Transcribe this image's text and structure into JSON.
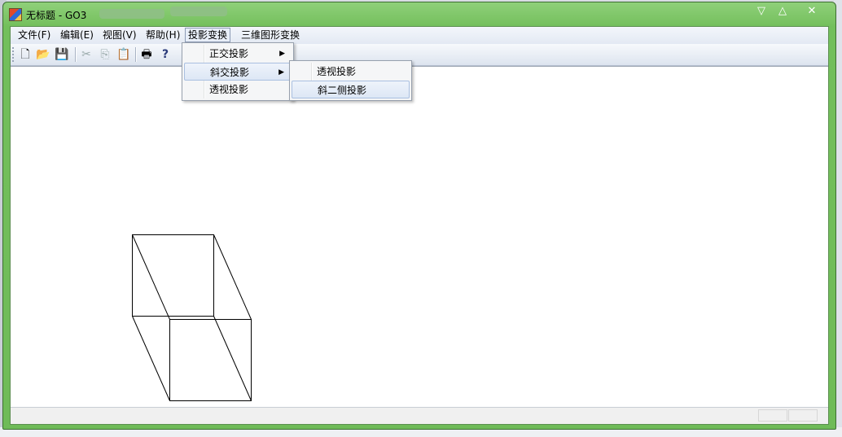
{
  "window": {
    "title": "无标题 - GO3",
    "buttons": {
      "minimize": "▽",
      "maximize": "△",
      "close": "✕"
    }
  },
  "menubar": {
    "items": [
      {
        "label": "文件(F)"
      },
      {
        "label": "编辑(E)"
      },
      {
        "label": "视图(V)"
      },
      {
        "label": "帮助(H)"
      },
      {
        "label": "投影变换"
      },
      {
        "label": "三维图形变换"
      }
    ]
  },
  "toolbar": {
    "buttons": [
      {
        "icon": "new-file-icon",
        "glyph": "🗋"
      },
      {
        "icon": "open-folder-icon",
        "glyph": "📂"
      },
      {
        "icon": "save-icon",
        "glyph": "💾"
      },
      {
        "icon": "cut-icon",
        "glyph": "✂"
      },
      {
        "icon": "copy-icon",
        "glyph": "⎘"
      },
      {
        "icon": "paste-icon",
        "glyph": "📋"
      },
      {
        "icon": "print-icon",
        "glyph": "🖶"
      },
      {
        "icon": "help-icon",
        "glyph": "?"
      }
    ]
  },
  "projection_menu": {
    "items": [
      {
        "label": "正交投影",
        "submenu": true
      },
      {
        "label": "斜交投影",
        "submenu": true
      },
      {
        "label": "透视投影",
        "submenu": false
      }
    ]
  },
  "oblique_submenu": {
    "items": [
      {
        "label": "透视投影"
      },
      {
        "label": "斜二侧投影"
      }
    ]
  },
  "colors": {
    "title_green": "#73bf5c",
    "highlight_border": "#a9bfe0"
  }
}
